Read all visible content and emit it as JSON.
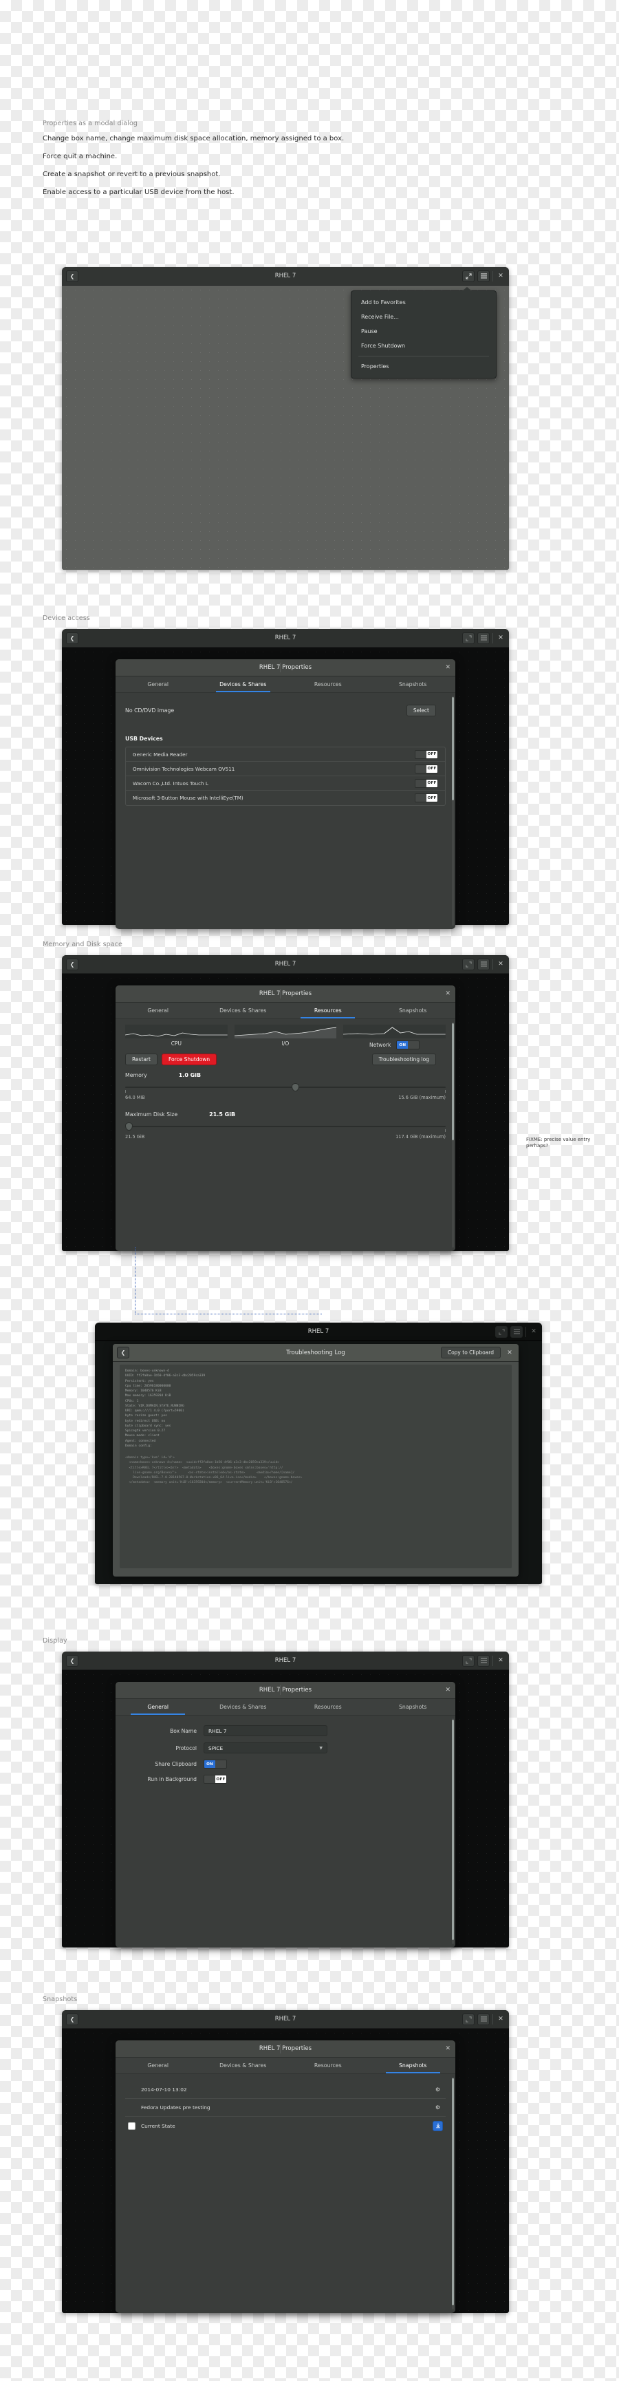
{
  "doc": {
    "section_properties": "Properties as a modal dialog",
    "bullets": [
      "Change box name, change maximum disk space allocation, memory assigned to a box.",
      "Force quit a machine.",
      "Create a snapshot or revert to a previous snapshot.",
      "Enable access to a particular USB device from the host."
    ],
    "section_device_access": "Device access",
    "section_memory_disk": "Memory and Disk space",
    "section_display": "Display",
    "section_snapshots": "Snapshots",
    "fixme_note": "FIXME: precise value entry perhaps?"
  },
  "window": {
    "title": "RHEL 7",
    "back_icon": "chevron-left-icon",
    "fullscreen_icon": "fullscreen-icon",
    "menu_icon": "hamburger-menu-icon",
    "close_icon": "close-icon"
  },
  "menu": {
    "items": [
      "Add to Favorites",
      "Receive File...",
      "Pause",
      "Force Shutdown"
    ],
    "after_divider": "Properties"
  },
  "dialog": {
    "title": "RHEL 7 Properties",
    "close_icon": "close-icon",
    "tabs": [
      "General",
      "Devices & Shares",
      "Resources",
      "Snapshots"
    ]
  },
  "devices_tab": {
    "cd_label": "No CD/DVD image",
    "select_button": "Select",
    "usb_header": "USB Devices",
    "devices": [
      {
        "name": "Generic Media Reader",
        "state": "OFF"
      },
      {
        "name": "Omnivision Technologies Webcam OV511",
        "state": "OFF"
      },
      {
        "name": "Wacom Co.,Ltd. Intuos Touch L",
        "state": "OFF"
      },
      {
        "name": "Microsoft 3-Button Mouse with IntelliEye(TM)",
        "state": "OFF"
      }
    ]
  },
  "resources_tab": {
    "graphs": [
      "CPU",
      "I/O",
      "Network"
    ],
    "network_toggle": "ON",
    "restart_button": "Restart",
    "force_shutdown_button": "Force Shutdown",
    "troubleshooting_button": "Troubleshooting log",
    "memory": {
      "label": "Memory",
      "value": "1.0 GiB",
      "min": "64.0 MiB",
      "max": "15.6 GiB (maximum)",
      "knob_pct": 53
    },
    "disk": {
      "label": "Maximum Disk Size",
      "value": "21.5 GiB",
      "min": "21.5 GiB",
      "max": "117.4 GiB (maximum)",
      "knob_pct": 1
    }
  },
  "general_tab": {
    "box_name_label": "Box Name",
    "box_name_value": "RHEL 7",
    "protocol_label": "Protocol",
    "protocol_value": "SPICE",
    "share_clipboard_label": "Share Clipboard",
    "share_clipboard_state": "ON",
    "run_background_label": "Run in Background",
    "run_background_state": "OFF"
  },
  "snapshots_tab": {
    "items": [
      {
        "name": "2014-07-10 13:02",
        "action": "gear-icon",
        "checked": false
      },
      {
        "name": "Fedora Updates pre testing",
        "action": "gear-icon",
        "checked": false
      },
      {
        "name": "Current State",
        "action": "save-icon",
        "checked": true
      }
    ]
  },
  "log_window": {
    "title": "Troubleshooting Log",
    "copy_button": "Copy to Clipboard",
    "back_icon": "chevron-left-icon",
    "close_icon": "close-icon",
    "lines": [
      "Domain: boxes-unknown-4",
      "UUID: ff2fa0ae-1b50-4f06-a3c3-dbc2059ca339",
      "Persistent: yes",
      "Cpu time: 20596180000000",
      "Memory: 1048576 KiB",
      "Max memory: 16359204 KiB",
      "CPUs: 1",
      "State: VIR_DOMAIN_STATE_RUNNING",
      "URI: qemu:///1 4.0 (?port=5900)",
      "byte resize guest: yes",
      "byte redirect USB: no",
      "byte clipboard sync: yes",
      "Spicegtk version 0.27",
      "Mouse mode: client",
      "Agent: connected",
      "",
      "Domain config:",
      "",
      "<domain type='kvm' id='4'>",
      "  <name>boxes-unknown-4</name>  <uuid>ff2fa0ae-1b50-4f06-a3c3-dbc2059ca339</uuid>",
      "  <title>RHEL 7</title><br/>  <metadata>    <boxes:gnome-boxes xmlns:boxes='http://",
      "    live-gnome.org/Boxes/'>      <os-state>installed</os-state>      <media>/home/[name]/",
      "    Downloads/RHEL-7.0-20140507.0-Workstation-x86_64-live.iso</media>    </boxes:gnome-boxes>",
      "  </metadata>  <memory unit='KiB'>16359204</memory>  <currentMemory unit='KiB'>1048576</"
    ]
  }
}
